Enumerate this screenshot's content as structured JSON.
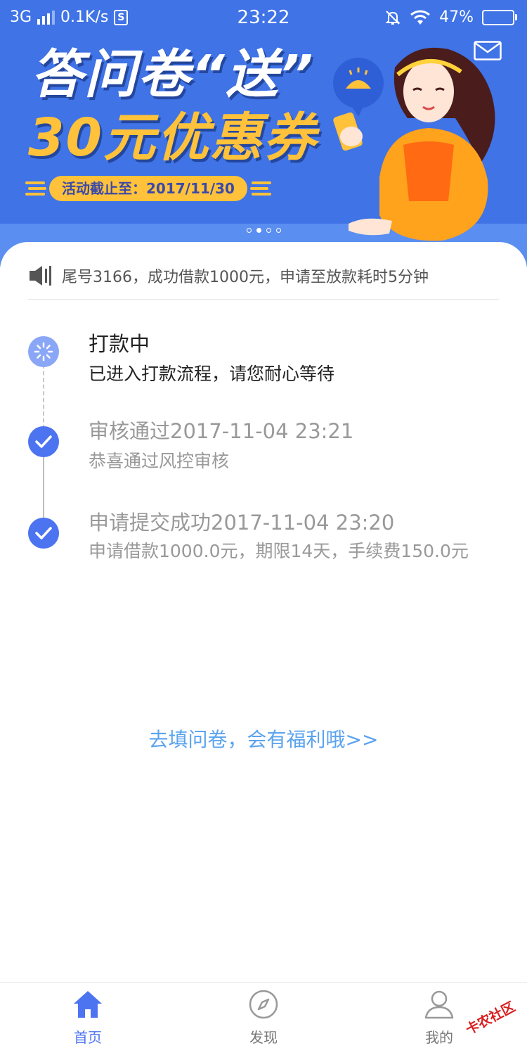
{
  "status_bar": {
    "network": "3G",
    "speed": "0.1K/s",
    "sim_badge": "S",
    "time": "23:22",
    "battery": "47%",
    "battery_fraction": 0.47
  },
  "banner": {
    "title": "答问卷“送”",
    "subtitle": "30元优惠券",
    "deadline": "活动截止至：2017/11/30",
    "carousel_total": 4,
    "carousel_active": 1,
    "mail_icon": "mail-icon"
  },
  "notice": {
    "icon": "speaker-icon",
    "text": "尾号3166，成功借款1000元，申请至放款耗时5分钟"
  },
  "timeline": [
    {
      "title": "打款中",
      "desc": "已进入打款流程，请您耐心等待",
      "state": "in-progress",
      "icon": "loading-icon"
    },
    {
      "title": "审核通过2017-11-04 23:21",
      "desc": "恭喜通过风控审核",
      "state": "done",
      "icon": "check-icon"
    },
    {
      "title": "申请提交成功2017-11-04 23:20",
      "desc": "申请借款1000.0元，期限14天，手续费150.0元",
      "state": "done",
      "icon": "check-icon"
    }
  ],
  "survey_link": "去填问卷，会有福利哦>>",
  "tabbar": {
    "home": "首页",
    "discover": "发现",
    "mine": "我的"
  },
  "watermark": "卡农社区",
  "colors": {
    "banner_blue": "#3f73e6",
    "accent_blue": "#4c73f0",
    "link_blue": "#5aa3ee",
    "coupon_yellow": "#ffc23a"
  }
}
